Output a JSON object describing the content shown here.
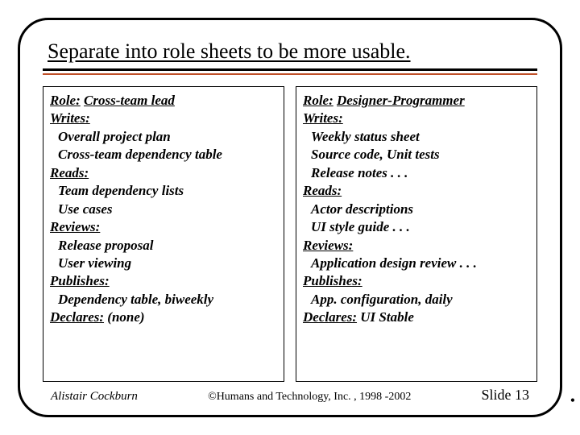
{
  "title": "Separate into role sheets to be more usable.",
  "roles": {
    "left": {
      "role_label": "Role:",
      "role_name": "Cross-team lead",
      "writes_label": "Writes:",
      "writes_items": [
        "Overall project plan",
        "Cross-team dependency table"
      ],
      "reads_label": "Reads:",
      "reads_items": [
        "Team dependency lists",
        "Use cases"
      ],
      "reviews_label": "Reviews:",
      "reviews_items": [
        "Release proposal",
        "User viewing"
      ],
      "publishes_label": "Publishes:",
      "publishes_items": [
        "Dependency table, biweekly"
      ],
      "declares_label": "Declares:",
      "declares_value": "(none)"
    },
    "right": {
      "role_label": "Role:",
      "role_name": "Designer-Programmer",
      "writes_label": "Writes:",
      "writes_items": [
        "Weekly status sheet",
        "Source code, Unit tests",
        "Release notes  . . ."
      ],
      "reads_label": "Reads:",
      "reads_items": [
        "Actor descriptions",
        "UI style guide  . . ."
      ],
      "reviews_label": "Reviews:",
      "reviews_items": [
        "Application design review . . ."
      ],
      "publishes_label": "Publishes:",
      "publishes_items": [
        "App. configuration, daily"
      ],
      "declares_label": "Declares:",
      "declares_value": "UI Stable"
    }
  },
  "footer": {
    "author": "Alistair Cockburn",
    "copyright": "©Humans and Technology, Inc. , 1998 -2002",
    "slide": "Slide 13"
  }
}
